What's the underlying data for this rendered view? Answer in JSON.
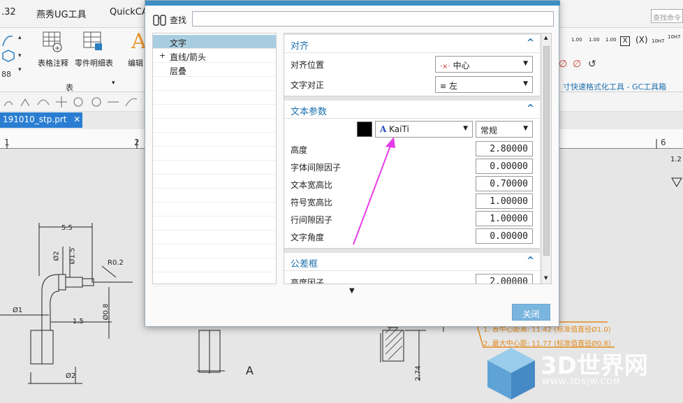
{
  "topbar": {
    "menu": [
      ".32",
      "燕秀UG工具",
      "QuickCA"
    ],
    "search_placeholder": "查找命令"
  },
  "ribbon": {
    "buttons": [
      "表格注释",
      "零件明细表",
      "编辑"
    ],
    "group_label": "表",
    "right_caption": "寸快速格式化工具 - GC工具箱",
    "mini_labels": [
      "1.00",
      "1.00",
      "1.00",
      "1.00",
      "10H7"
    ]
  },
  "document_tab": {
    "label": "191010_stp.prt"
  },
  "ruler": {
    "numbers": [
      "1",
      "2",
      "6"
    ]
  },
  "drawing": {
    "dims": [
      "5.5",
      "Ø2",
      "Ø1.5",
      "R0.2",
      "Ø1",
      "1.5",
      "Ø0.8",
      "Ø2",
      "A",
      "2.74",
      "1.2"
    ],
    "notes": [
      "1. 表中心距离: 11.42 (标准值直径Ø1.0)",
      "2. 最大中心距: 11.77 (标准值直径Ø0.8)"
    ]
  },
  "watermark": {
    "title": "3D世界网",
    "url": "WWW.3DSJW.COM"
  },
  "dialog": {
    "find_label": "查找",
    "tree": [
      {
        "label": "文字",
        "selected": true,
        "expandable": false
      },
      {
        "label": "直线/箭头",
        "selected": false,
        "expandable": true
      },
      {
        "label": "层叠",
        "selected": false,
        "expandable": false
      }
    ],
    "sections": {
      "align": {
        "title": "对齐",
        "position_label": "对齐位置",
        "position_value": "中心",
        "justify_label": "文字对正",
        "justify_value": "左"
      },
      "text_params": {
        "title": "文本参数",
        "color": "#000000",
        "font_value": "KaiTi",
        "style_value": "常规",
        "fields": [
          {
            "label": "高度",
            "value": "2.80000"
          },
          {
            "label": "字体间隙因子",
            "value": "0.00000"
          },
          {
            "label": "文本宽高比",
            "value": "0.70000"
          },
          {
            "label": "符号宽高比",
            "value": "1.00000"
          },
          {
            "label": "行间隙因子",
            "value": "1.00000"
          },
          {
            "label": "文字角度",
            "value": "0.00000"
          }
        ]
      },
      "tolerance": {
        "title": "公差框",
        "field_label": "高度因子",
        "field_value": "2.00000"
      }
    },
    "close_label": "关闭"
  },
  "annotation_color": "#e53be8"
}
